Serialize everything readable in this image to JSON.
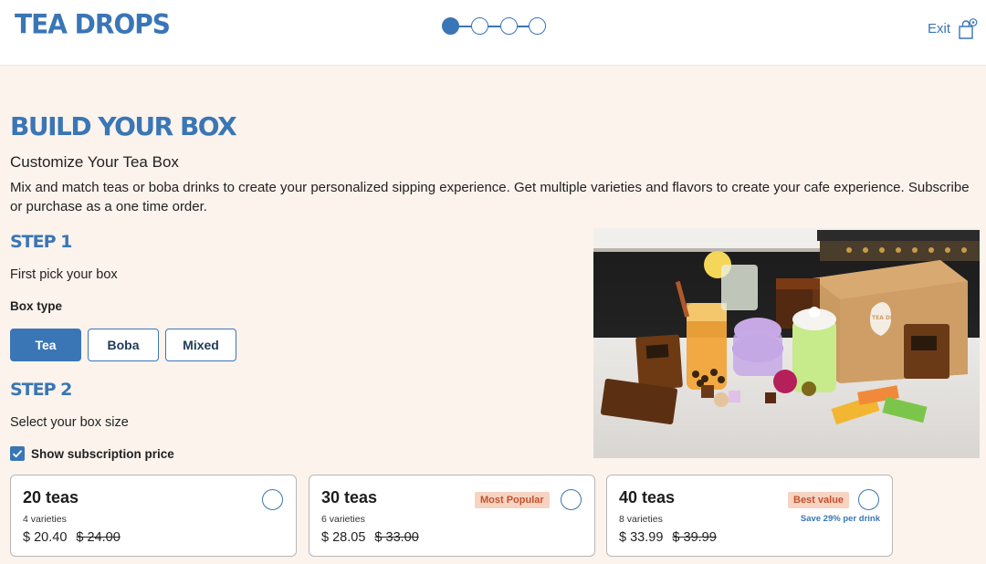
{
  "header": {
    "logo": "TEA DROPS",
    "progress": {
      "total_steps": 4,
      "current_step": 1
    },
    "exit_label": "Exit"
  },
  "page": {
    "title": "BUILD YOUR BOX",
    "subtitle": "Customize Your Tea Box",
    "description": "Mix and match teas or boba drinks to create your personalized sipping experience. Get multiple varieties and flavors to create your cafe experience. Subscribe or purchase as a one time order."
  },
  "step1": {
    "heading": "STEP 1",
    "instruction": "First pick your box",
    "box_type_label": "Box type",
    "options": [
      {
        "label": "Tea",
        "selected": true
      },
      {
        "label": "Boba",
        "selected": false
      },
      {
        "label": "Mixed",
        "selected": false
      }
    ]
  },
  "step2": {
    "heading": "STEP 2",
    "instruction": "Select your box size",
    "subscription_label": "Show subscription price",
    "subscription_checked": true,
    "sizes": [
      {
        "title": "20 teas",
        "varieties": "4 varieties",
        "price": "$ 20.40",
        "original_price": "$ 24.00",
        "badge": "",
        "note": ""
      },
      {
        "title": "30 teas",
        "varieties": "6 varieties",
        "price": "$ 28.05",
        "original_price": "$ 33.00",
        "badge": "Most Popular",
        "note": ""
      },
      {
        "title": "40 teas",
        "varieties": "8 varieties",
        "price": "$ 33.99",
        "original_price": "$ 39.99",
        "badge": "Best value",
        "note": "Save 29% per drink"
      }
    ]
  },
  "product_photo": {
    "box_label": "TEA DROPS"
  },
  "colors": {
    "brand_blue": "#3a76b5",
    "page_bg": "#fbf3ec",
    "badge_bg": "#f7d3c2",
    "badge_text": "#c4512c"
  }
}
